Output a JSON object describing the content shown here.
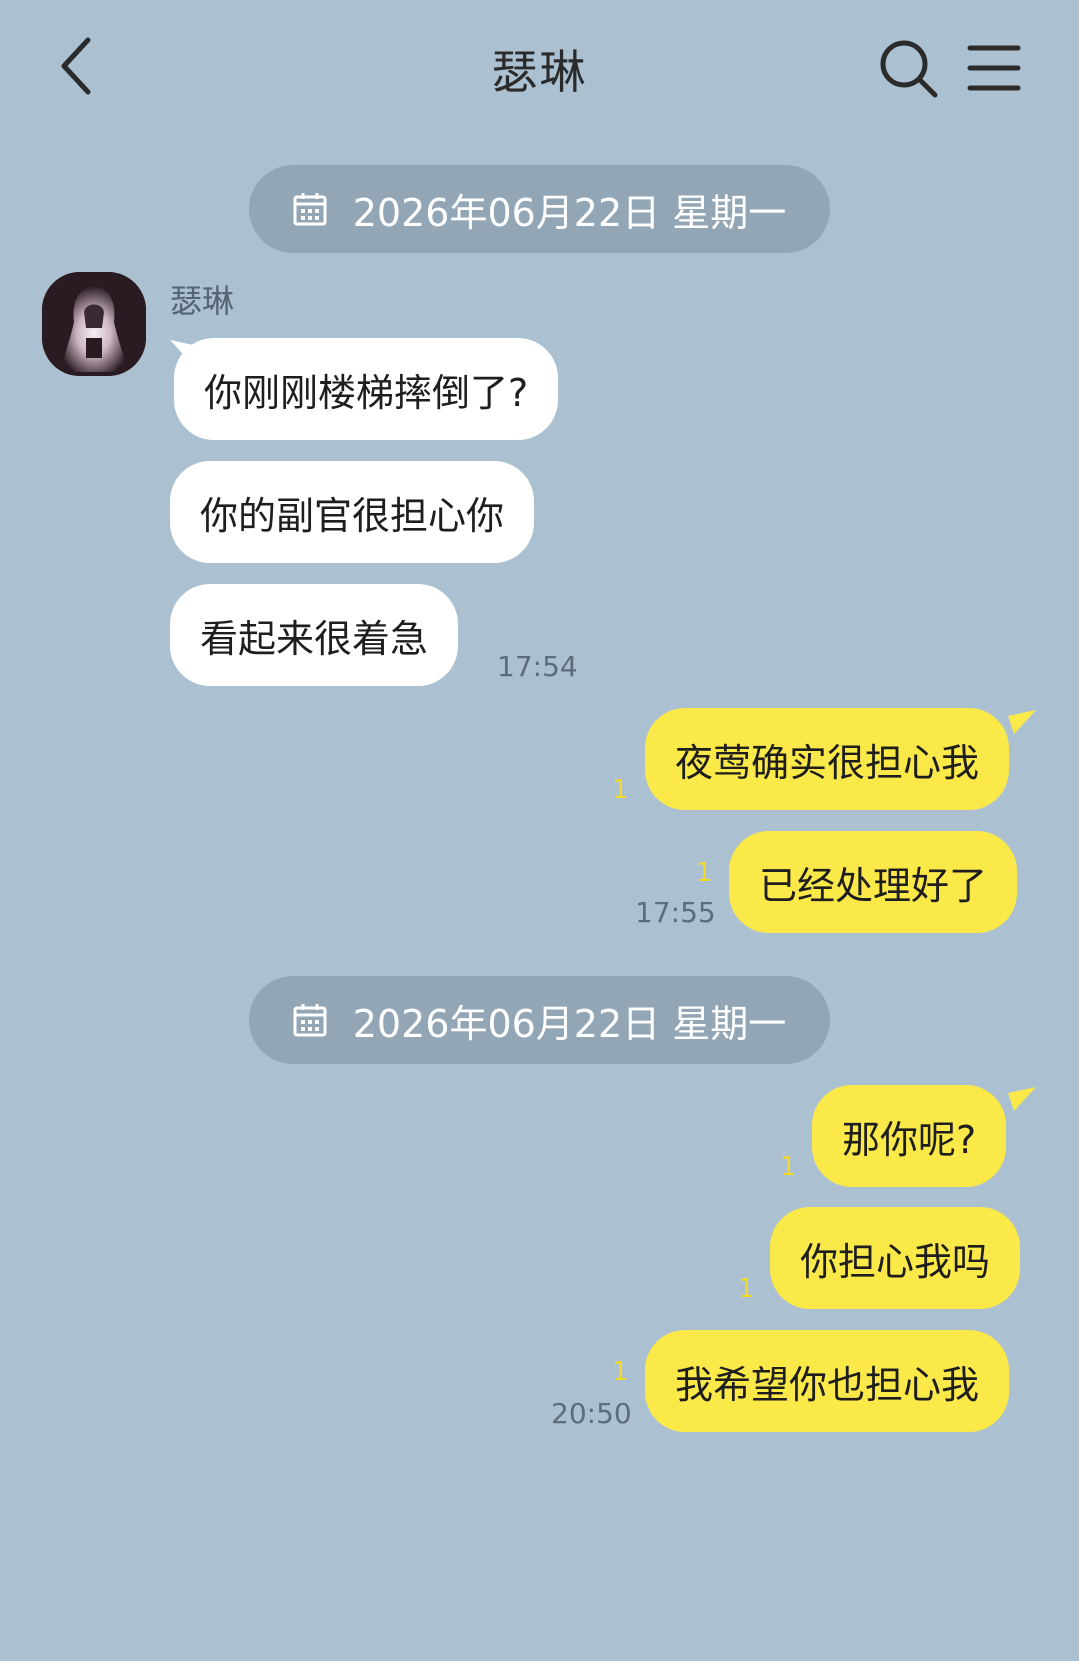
{
  "header": {
    "title": "瑟琳",
    "back_icon": "chevron-left-icon",
    "search_icon": "search-icon",
    "menu_icon": "menu-icon"
  },
  "dividers": [
    {
      "label": "2026年06月22日 星期一",
      "icon": "calendar-icon"
    },
    {
      "label": "2026年06月22日 星期一",
      "icon": "calendar-icon"
    }
  ],
  "friend": {
    "name": "瑟琳"
  },
  "messages_in": [
    {
      "text": "你刚刚楼梯摔倒了?"
    },
    {
      "text": "你的副官很担心你"
    },
    {
      "text": "看起来很着急",
      "time": "17:54"
    }
  ],
  "messages_out_1": [
    {
      "text": "夜莺确实很担心我",
      "unread": "1"
    },
    {
      "text": "已经处理好了",
      "unread": "1",
      "time": "17:55"
    }
  ],
  "messages_out_2": [
    {
      "text": "那你呢?",
      "unread": "1"
    },
    {
      "text": "你担心我吗",
      "unread": "1"
    },
    {
      "text": "我希望你也担心我",
      "unread": "1",
      "time": "20:50"
    }
  ],
  "colors": {
    "background": "#abc1d1",
    "incoming_bubble": "#ffffff",
    "outgoing_bubble": "#fbe949",
    "date_pill": "#92a6b6",
    "unread_counter": "#f2d928"
  }
}
